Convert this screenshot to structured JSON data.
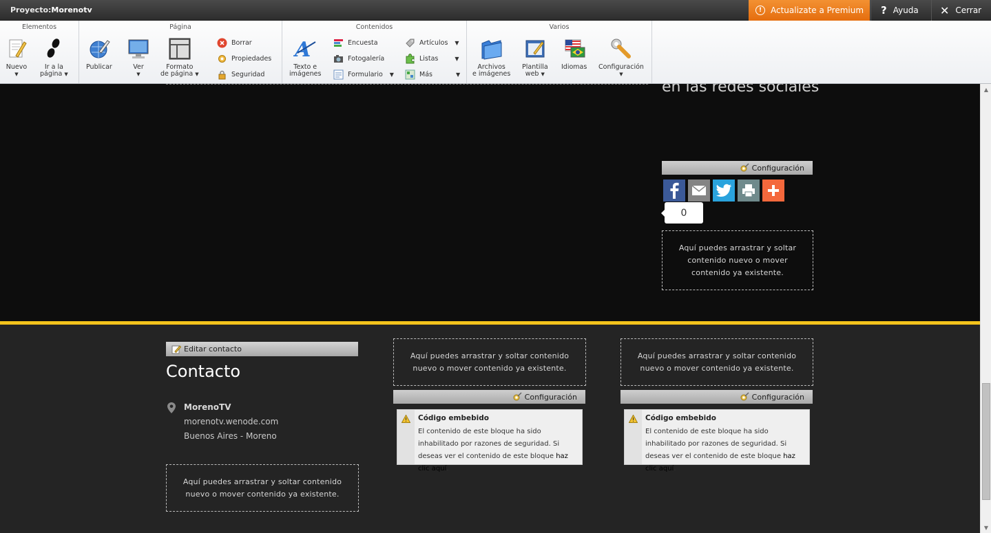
{
  "titlebar": {
    "project_label": "Proyecto:",
    "project_name": "Morenotv",
    "premium": "Actualizate a Premium",
    "help": "Ayuda",
    "close": "Cerrar"
  },
  "ribbon": {
    "groups": {
      "elementos": "Elementos",
      "pagina": "Página",
      "contenidos": "Contenidos",
      "varios": "Varios"
    },
    "nuevo": "Nuevo",
    "ir_a_pagina": [
      "Ir a la",
      "página"
    ],
    "publicar": "Publicar",
    "ver": "Ver",
    "formato": [
      "Formato",
      "de página"
    ],
    "borrar": "Borrar",
    "propiedades": "Propiedades",
    "seguridad": "Seguridad",
    "texto": [
      "Texto e",
      "imágenes"
    ],
    "encuesta": "Encuesta",
    "fotogaleria": "Fotogalería",
    "formulario": "Formulario",
    "articulos": "Artículos",
    "listas": "Listas",
    "mas": "Más",
    "archivos": [
      "Archivos",
      "e imágenes"
    ],
    "plantilla": [
      "Plantilla",
      "web"
    ],
    "idiomas": "Idiomas",
    "configuracion": "Configuración"
  },
  "main": {
    "social_title": "en las redes sociales",
    "config_label": "Configuración",
    "share_count": "0",
    "drop_text": "Aquí puedes arrastrar y soltar contenido nuevo o mover contenido ya existente."
  },
  "footer": {
    "edit_contact": "Editar contacto",
    "contact_title": "Contacto",
    "contact_name": "MorenoTV",
    "contact_url": "morenotv.wenode.com",
    "contact_location": "Buenos Aires - Moreno",
    "embed_title": "Código embebido",
    "embed_body": "El contenido de este bloque ha sido inhabilitado por razones de seguridad. Si deseas ver el contenido de este bloque ",
    "embed_link": "haz clic aquí",
    "embed_end": "."
  },
  "colors": {
    "premium": "#e56d0e",
    "accent_line": "#f3c31c",
    "facebook": "#3b5998",
    "email": "#848484",
    "twitter": "#2aa3dd",
    "print": "#6f8a8c",
    "more": "#f4683c"
  }
}
